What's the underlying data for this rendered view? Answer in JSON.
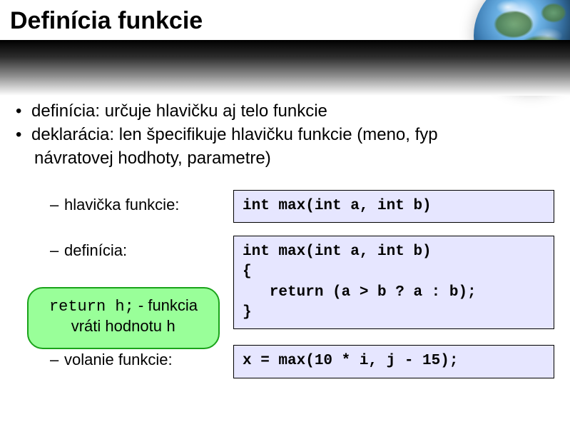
{
  "title": "Definícia funkcie",
  "bullets": {
    "b1": "definícia: určuje hlavičku aj telo funkcie",
    "b2a": "deklarácia: len špecifikuje hlavičku funkcie (meno, fyp",
    "b2b": "návratovej hodhoty, parametre)"
  },
  "labels": {
    "header": "hlavička funkcie:",
    "definition": "definícia:",
    "call": "volanie funkcie:"
  },
  "code": {
    "header": "int max(int a, int b)",
    "definition": "int max(int a, int b)\n{\n   return (a > b ? a : b);\n}",
    "call": "x = max(10 * i, j - 15);"
  },
  "callout": {
    "mono1": "return h;",
    "text1": " - funkcia",
    "text2": "vráti hodnotu ",
    "mono2": "h"
  }
}
